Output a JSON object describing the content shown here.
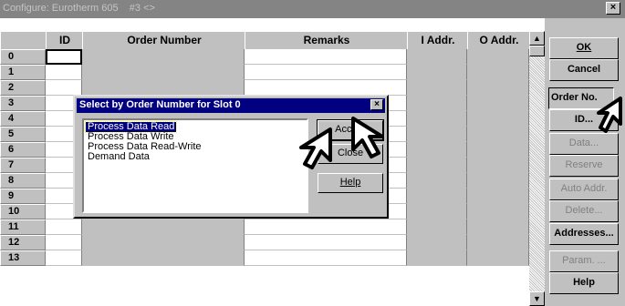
{
  "window": {
    "title": "Configure: Eurotherm 605    #3 <>",
    "close_glyph": "×"
  },
  "grid": {
    "columns": [
      "ID",
      "Order Number",
      "Remarks",
      "I Addr.",
      "O Addr."
    ],
    "rows": [
      "0",
      "1",
      "2",
      "3",
      "4",
      "5",
      "6",
      "7",
      "8",
      "9",
      "10",
      "11",
      "12",
      "13"
    ]
  },
  "scrollbar": {
    "up_glyph": "▲",
    "down_glyph": "▼"
  },
  "buttons": {
    "ok": "OK",
    "cancel": "Cancel",
    "order_no": "Order No.",
    "id": "ID...",
    "data": "Data...",
    "reserve": "Reserve",
    "auto_addr": "Auto Addr.",
    "delete": "Delete...",
    "addresses": "Addresses...",
    "param": "Param. ...",
    "help": "Help"
  },
  "dialog": {
    "title": "Select by Order Number for Slot 0",
    "close_glyph": "×",
    "list": [
      "Process Data Read",
      "Process Data Write",
      "Process Data Read-Write",
      "Demand Data"
    ],
    "selected_index": 0,
    "accept": "Accept",
    "close": "Close",
    "help": "Help"
  }
}
